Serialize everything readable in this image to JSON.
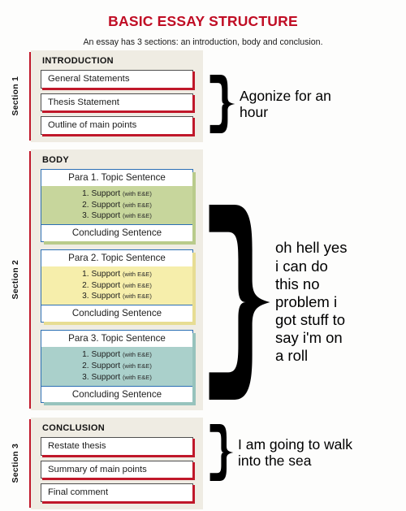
{
  "header": {
    "title": "BASIC ESSAY STRUCTURE",
    "subtitle": "An essay has 3 sections:  an introduction, body and conclusion.",
    "title_color": "#c00d24"
  },
  "colors": {
    "title_red": "#c00d24",
    "rule_red": "#c0182a",
    "panel_beige": "#efece3",
    "para_border_blue": "#2b6fb4",
    "support_green": "#c7d69c",
    "support_yellow": "#f6eeab",
    "support_teal": "#aad0cb",
    "shadow_green": "#b9cb8b",
    "shadow_yellow": "#e7dd93",
    "shadow_teal": "#97c3bd",
    "text_dark": "#1d1d1d"
  },
  "sections": [
    {
      "label": "Section 1",
      "heading": "INTRODUCTION",
      "type": "simple",
      "rows": [
        "General Statements",
        "Thesis Statement",
        "Outline of main points"
      ]
    },
    {
      "label": "Section 2",
      "heading": "BODY",
      "type": "paragraphs",
      "paragraphs": [
        {
          "topic": "Para 1.  Topic Sentence",
          "supports": [
            {
              "num": "1. Support",
              "note": "(with E&E)"
            },
            {
              "num": "2. Support",
              "note": "(with E&E)"
            },
            {
              "num": "3. Support",
              "note": "(with E&E)"
            }
          ],
          "concluding": "Concluding Sentence",
          "fill": "#c7d69c",
          "shadow": "#b9cb8b"
        },
        {
          "topic": "Para 2.  Topic Sentence",
          "supports": [
            {
              "num": "1. Support",
              "note": "(with E&E)"
            },
            {
              "num": "2. Support",
              "note": "(with E&E)"
            },
            {
              "num": "3. Support",
              "note": "(with E&E)"
            }
          ],
          "concluding": "Concluding Sentence",
          "fill": "#f6eeab",
          "shadow": "#e7dd93"
        },
        {
          "topic": "Para 3.  Topic Sentence",
          "supports": [
            {
              "num": "1. Support",
              "note": "(with E&E)"
            },
            {
              "num": "2. Support",
              "note": "(with E&E)"
            },
            {
              "num": "3. Support",
              "note": "(with E&E)"
            }
          ],
          "concluding": "Concluding Sentence",
          "fill": "#aad0cb",
          "shadow": "#97c3bd"
        }
      ]
    },
    {
      "label": "Section 3",
      "heading": "CONCLUSION",
      "type": "simple",
      "rows": [
        "Restate thesis",
        "Summary of main points",
        "Final comment"
      ]
    }
  ],
  "annotations": [
    {
      "id": "intro-annotation",
      "text": "Agonize for an\nhour",
      "size": "normal"
    },
    {
      "id": "body-annotation",
      "text": "oh hell yes\ni can do\nthis no\nproblem i\ngot stuff to\nsay i'm on\na roll",
      "size": "big"
    },
    {
      "id": "conclusion-annotation",
      "text": "I am going to walk\ninto the sea",
      "size": "normal"
    }
  ]
}
